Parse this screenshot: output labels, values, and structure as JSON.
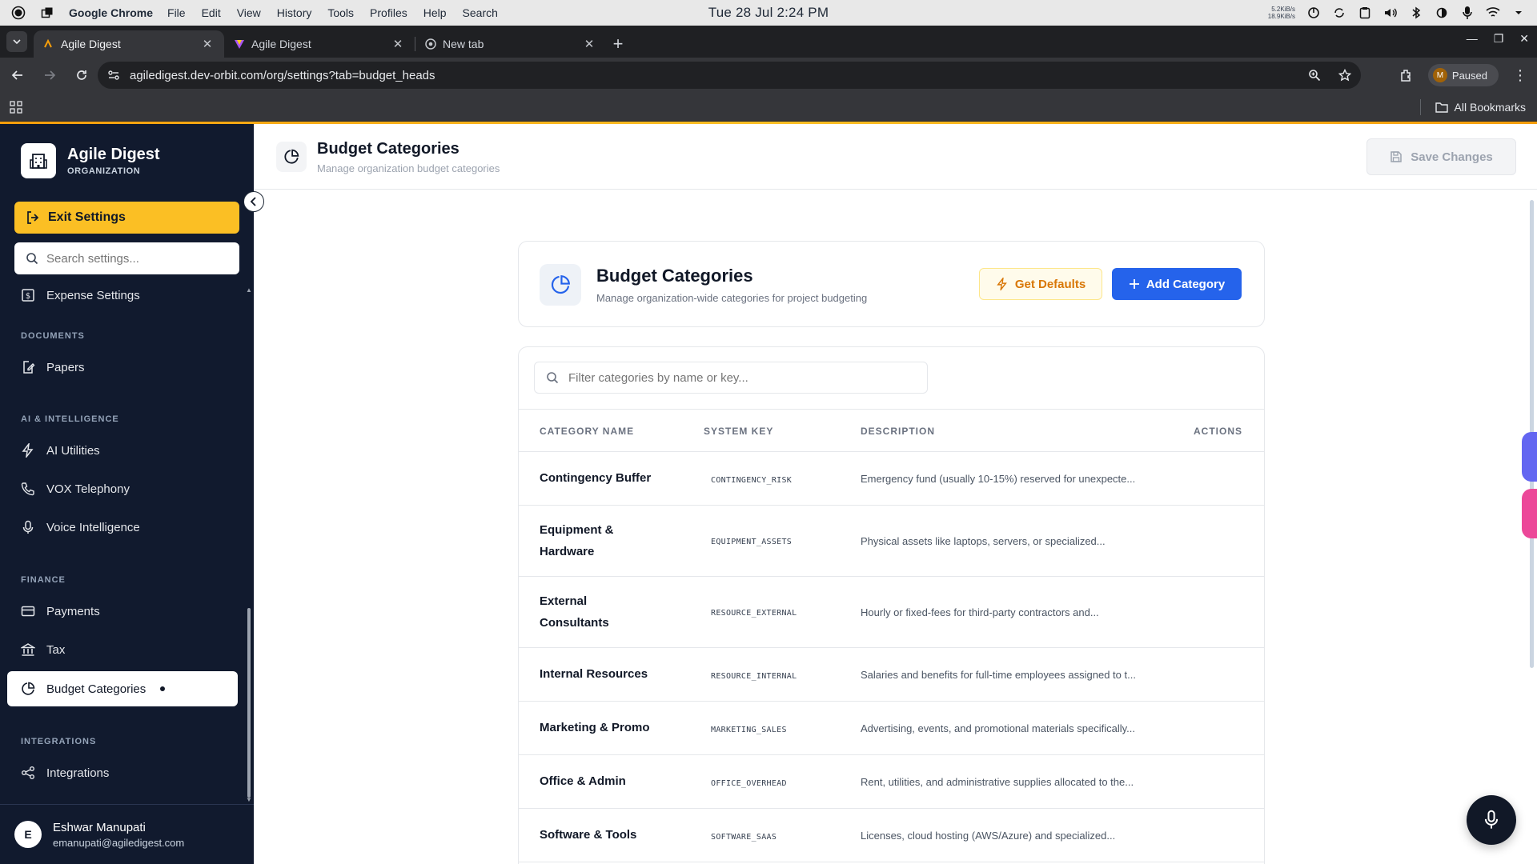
{
  "os": {
    "app_name": "Google Chrome",
    "menu": [
      "File",
      "Edit",
      "View",
      "History",
      "Tools",
      "Profiles",
      "Help",
      "Search"
    ],
    "clock": "Tue 28 Jul  2:24 PM",
    "net_up": "5.2KiB/s",
    "net_down": "18.9KiB/s"
  },
  "browser": {
    "tabs": [
      {
        "title": "Agile Digest",
        "active": true
      },
      {
        "title": "Agile Digest",
        "active": false
      },
      {
        "title": "New tab",
        "active": false
      }
    ],
    "url": "agiledigest.dev-orbit.com/org/settings?tab=budget_heads",
    "profile_initial": "M",
    "profile_status": "Paused",
    "bookmarks_label": "All Bookmarks"
  },
  "sidebar": {
    "brand_name": "Agile Digest",
    "brand_sub": "ORGANIZATION",
    "exit_label": "Exit Settings",
    "search_placeholder": "Search settings...",
    "top_item": "Expense Settings",
    "sections": {
      "documents": "DOCUMENTS",
      "ai": "AI & INTELLIGENCE",
      "finance": "FINANCE",
      "integrations": "INTEGRATIONS"
    },
    "items": {
      "papers": "Papers",
      "ai_utilities": "AI Utilities",
      "vox": "VOX Telephony",
      "voice": "Voice Intelligence",
      "payments": "Payments",
      "tax": "Tax",
      "budget": "Budget Categories",
      "integrations": "Integrations"
    },
    "user": {
      "initial": "E",
      "name": "Eshwar Manupati",
      "email": "emanupati@agiledigest.com"
    }
  },
  "page": {
    "title": "Budget Categories",
    "subtitle": "Manage organization budget categories",
    "save_label": "Save Changes"
  },
  "card": {
    "title": "Budget Categories",
    "subtitle": "Manage organization-wide categories for project budgeting",
    "defaults_label": "Get Defaults",
    "add_label": "Add Category"
  },
  "table": {
    "filter_placeholder": "Filter categories by name or key...",
    "headers": {
      "name": "CATEGORY NAME",
      "key": "SYSTEM KEY",
      "desc": "DESCRIPTION",
      "actions": "ACTIONS"
    },
    "rows": [
      {
        "name": "Contingency Buffer",
        "key": "CONTINGENCY_RISK",
        "desc": "Emergency fund (usually 10-15%) reserved for unexpecte..."
      },
      {
        "name": "Equipment & Hardware",
        "key": "EQUIPMENT_ASSETS",
        "desc": "Physical assets like laptops, servers, or specialized..."
      },
      {
        "name": "External Consultants",
        "key": "RESOURCE_EXTERNAL",
        "desc": "Hourly or fixed-fees for third-party contractors and..."
      },
      {
        "name": "Internal Resources",
        "key": "RESOURCE_INTERNAL",
        "desc": "Salaries and benefits for full-time employees assigned to t..."
      },
      {
        "name": "Marketing & Promo",
        "key": "MARKETING_SALES",
        "desc": "Advertising, events, and promotional materials specifically..."
      },
      {
        "name": "Office & Admin",
        "key": "OFFICE_OVERHEAD",
        "desc": "Rent, utilities, and administrative supplies allocated to the..."
      },
      {
        "name": "Software & Tools",
        "key": "SOFTWARE_SAAS",
        "desc": "Licenses, cloud hosting (AWS/Azure) and specialized..."
      }
    ]
  },
  "colors": {
    "sidebar_bg": "#111a2e",
    "accent_yellow": "#fbbf24",
    "primary_blue": "#2563eb"
  }
}
